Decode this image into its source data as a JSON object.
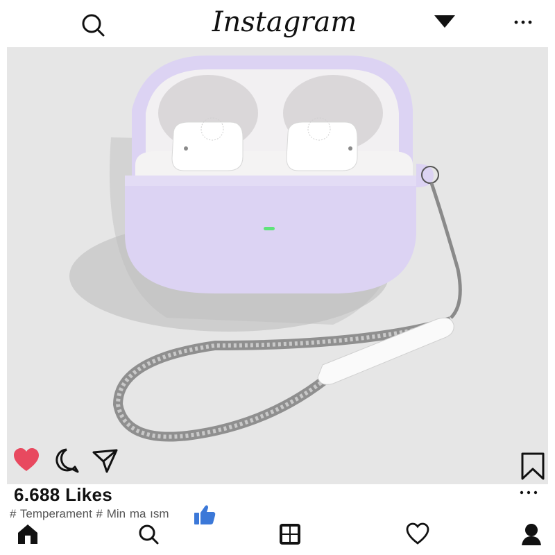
{
  "header": {
    "logo_text": "Instagram",
    "search_icon": "search-icon",
    "dropdown_icon": "caret-down-icon",
    "more_icon": "more-dots-icon"
  },
  "post": {
    "image_description_icon": "product-photo",
    "like_icon": "heart-filled-icon",
    "comment_icon": "comment-icon",
    "share_icon": "send-icon",
    "save_icon": "bookmark-icon",
    "liked": true
  },
  "likes_text": "6.688 Likes",
  "tags_text": "# Temperament # Min ma ısm",
  "bottom_nav": [
    "home-icon",
    "search-icon",
    "create-icon",
    "activity-icon",
    "profile-icon"
  ],
  "colors": {
    "heart": "#e8495f",
    "case": "#dcd3f3",
    "background": "#e6e6e6",
    "thumb": "#3b78d8"
  }
}
